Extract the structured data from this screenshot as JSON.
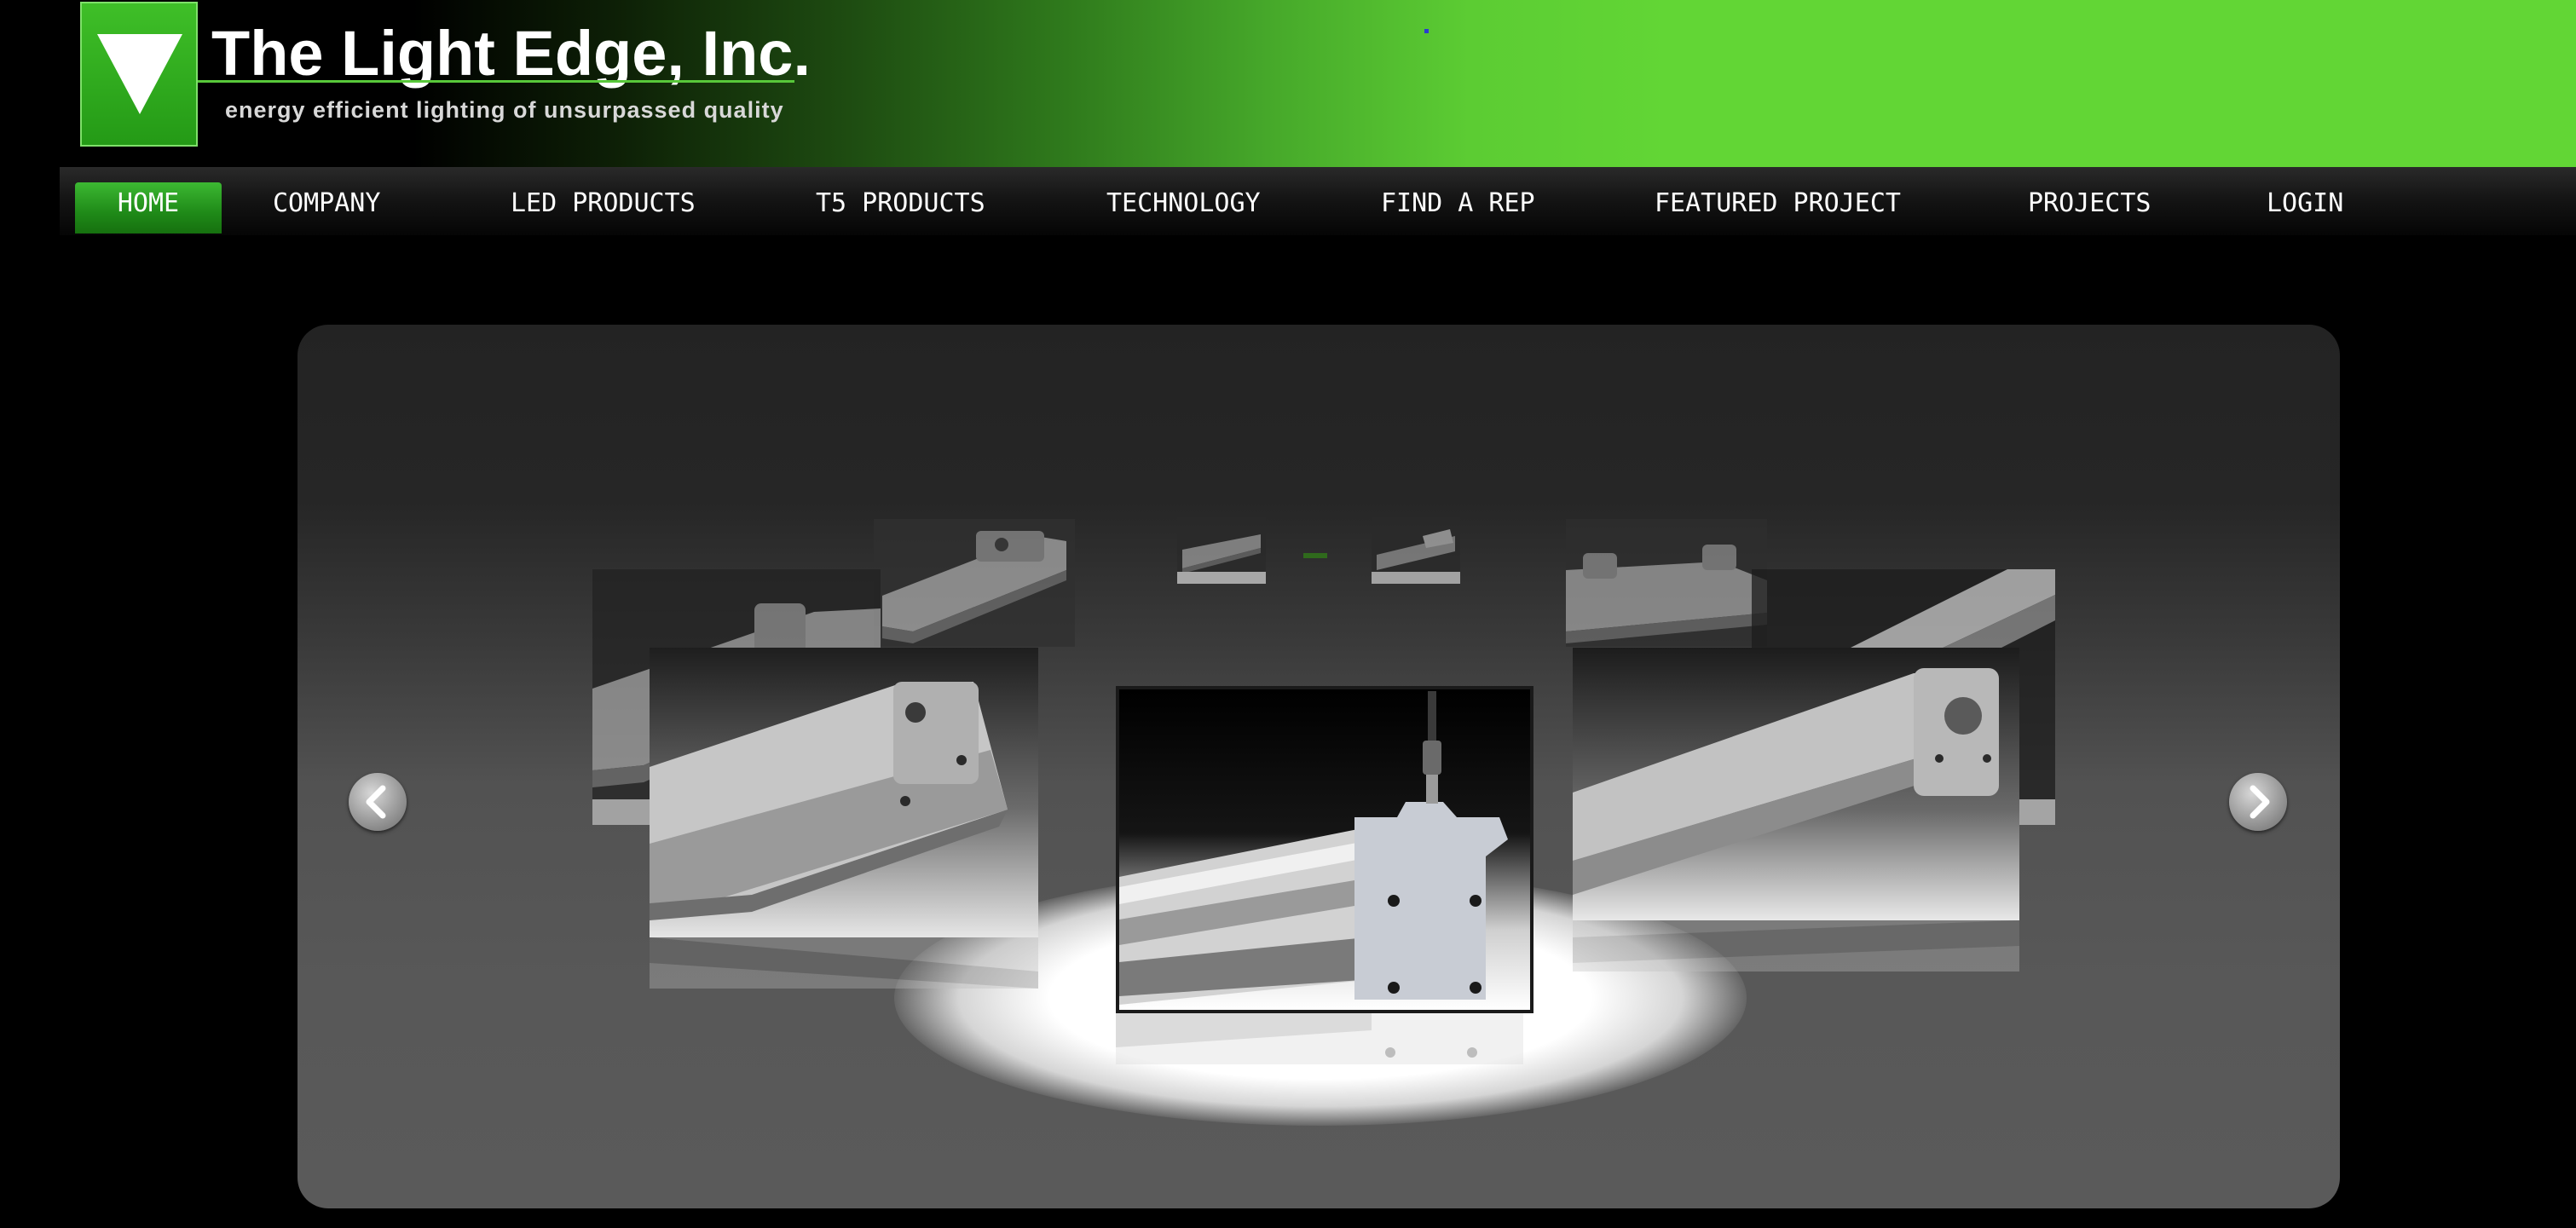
{
  "header": {
    "logo_title": "The Light Edge, Inc.",
    "logo_tagline": "energy efficient lighting of unsurpassed quality",
    "logo_icon": "triangle-down-logo-icon"
  },
  "nav": {
    "items": [
      {
        "label": "HOME",
        "active": true
      },
      {
        "label": "COMPANY",
        "active": false
      },
      {
        "label": "LED PRODUCTS",
        "active": false
      },
      {
        "label": "T5 PRODUCTS",
        "active": false
      },
      {
        "label": "TECHNOLOGY",
        "active": false
      },
      {
        "label": "FIND A REP",
        "active": false
      },
      {
        "label": "FEATURED PROJECT",
        "active": false
      },
      {
        "label": "PROJECTS",
        "active": false
      },
      {
        "label": "LOGIN",
        "active": false
      }
    ]
  },
  "carousel": {
    "prev_icon": "chevron-left-icon",
    "next_icon": "chevron-right-icon",
    "slide_count": 9
  },
  "colors": {
    "brand_green": "#62d635",
    "nav_active_green": "#2aa222",
    "background": "#000000"
  }
}
